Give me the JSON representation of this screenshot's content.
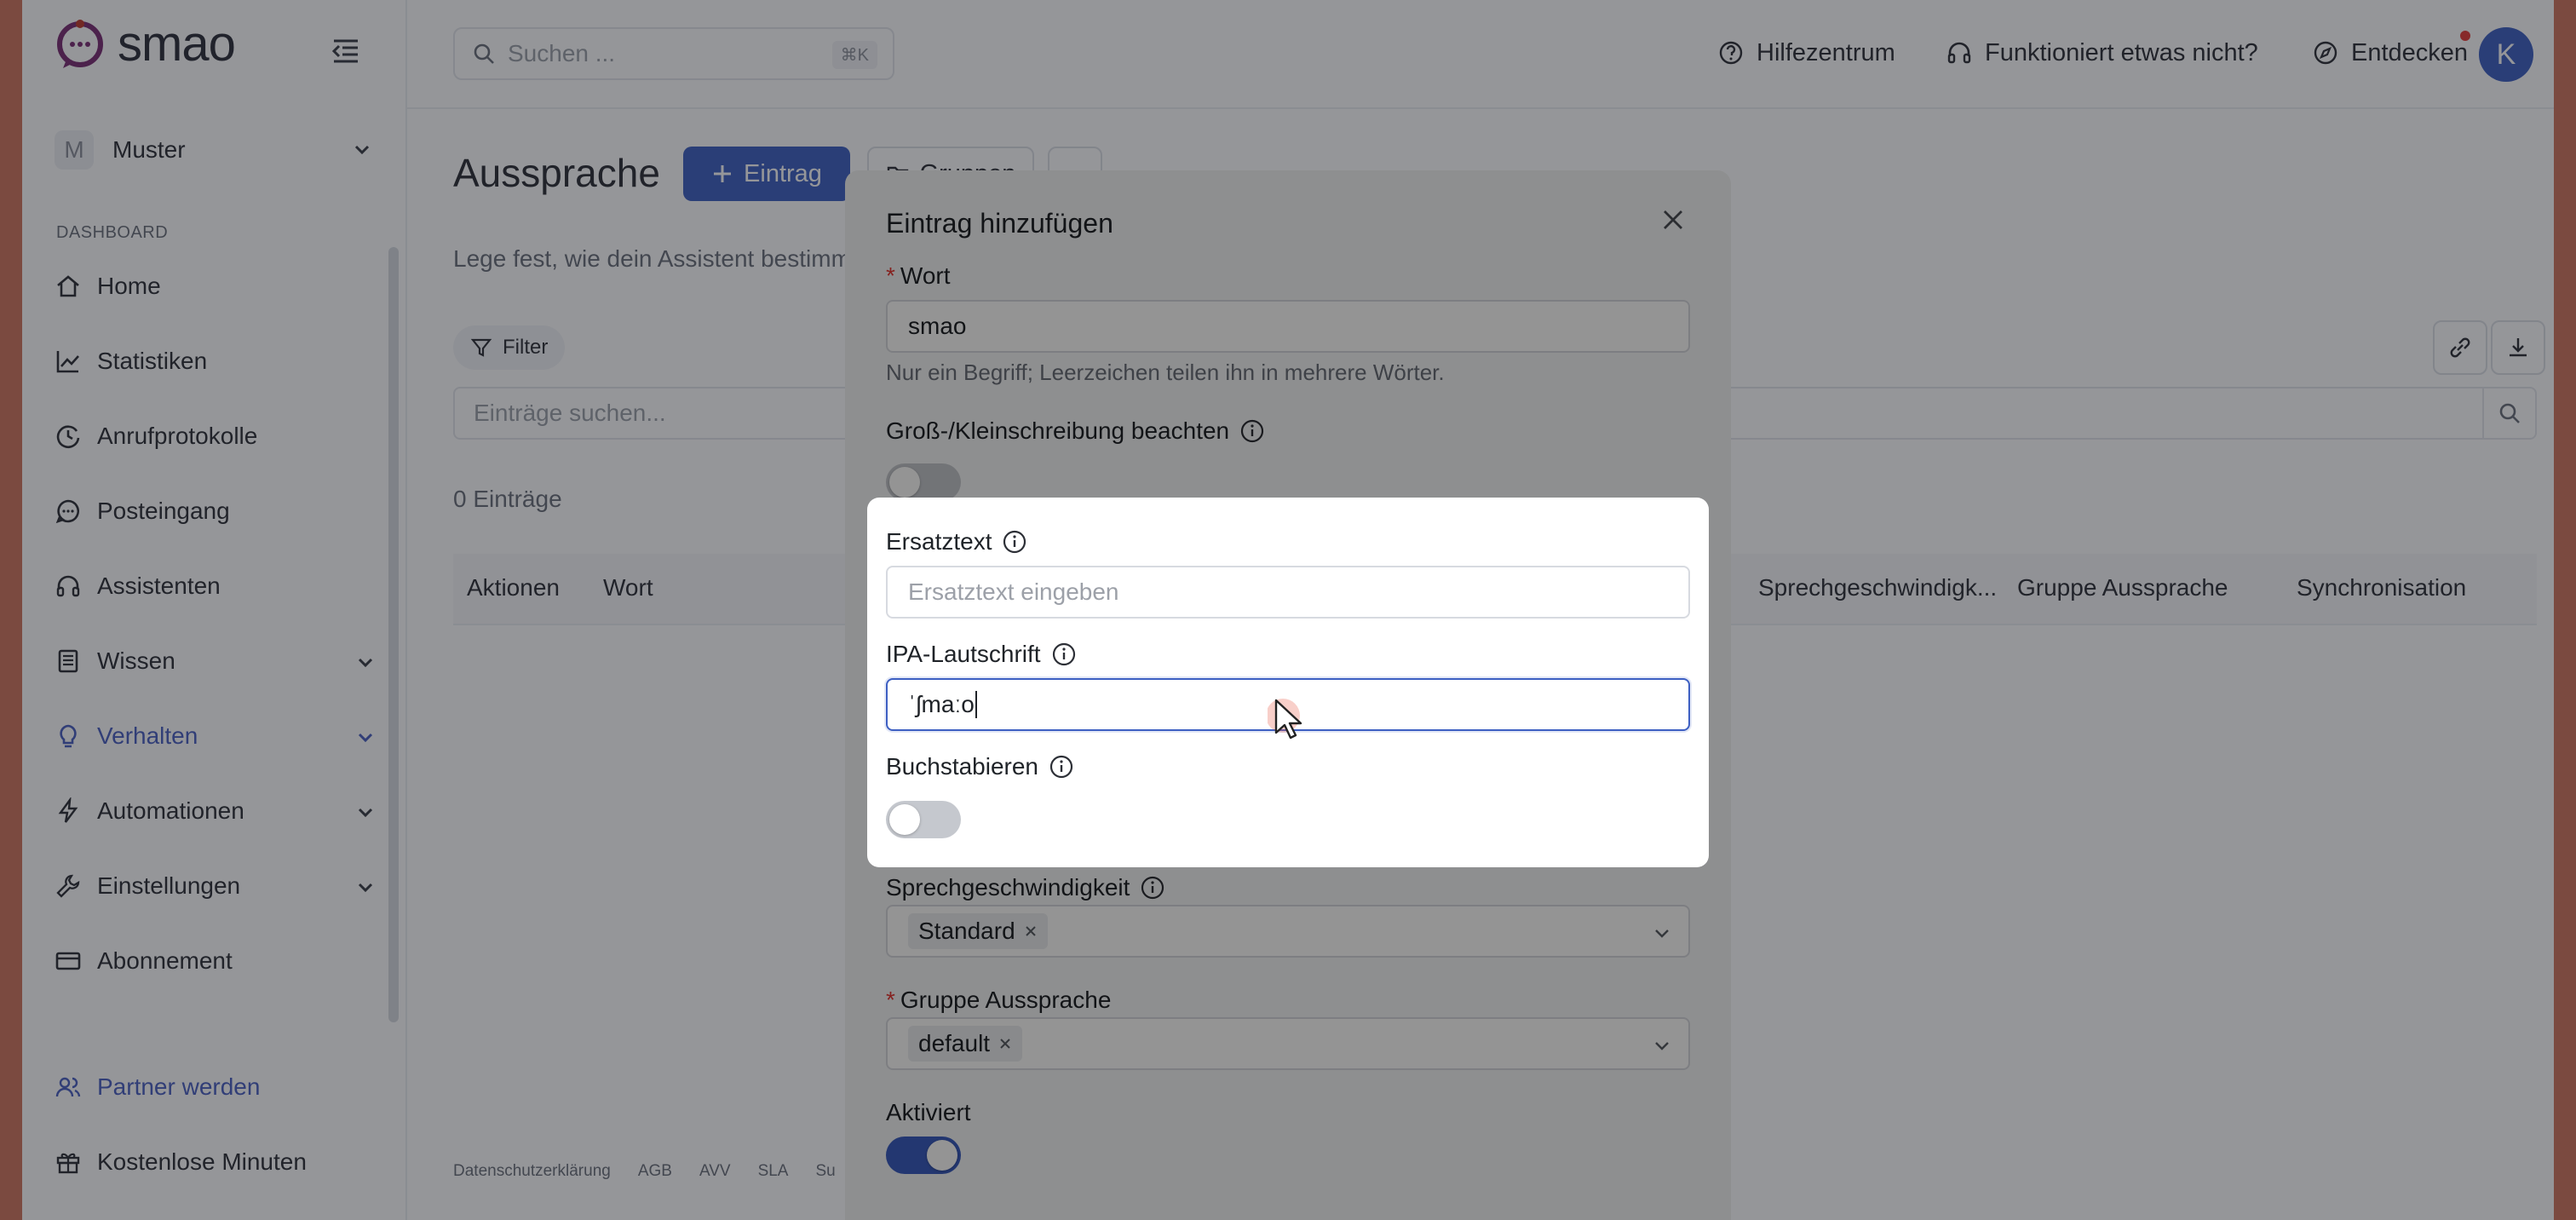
{
  "brand": {
    "name": "smao"
  },
  "workspace": {
    "initial": "M",
    "name": "Muster"
  },
  "sidebar": {
    "section": "DASHBOARD",
    "items": [
      {
        "label": "Home",
        "icon": "home-icon"
      },
      {
        "label": "Statistiken",
        "icon": "chart-icon"
      },
      {
        "label": "Anrufprotokolle",
        "icon": "history-icon"
      },
      {
        "label": "Posteingang",
        "icon": "chat-icon"
      },
      {
        "label": "Assistenten",
        "icon": "headset-icon"
      },
      {
        "label": "Wissen",
        "icon": "book-icon"
      },
      {
        "label": "Verhalten",
        "icon": "bulb-icon"
      },
      {
        "label": "Automationen",
        "icon": "bolt-icon"
      },
      {
        "label": "Einstellungen",
        "icon": "wrench-icon"
      },
      {
        "label": "Abonnement",
        "icon": "card-icon"
      }
    ],
    "partner": "Partner werden",
    "free_minutes": "Kostenlose Minuten"
  },
  "topbar": {
    "search_placeholder": "Suchen ...",
    "search_shortcut": "⌘K",
    "help_center": "Hilfezentrum",
    "not_working": "Funktioniert etwas nicht?",
    "discover": "Entdecken",
    "user_initial": "K"
  },
  "page": {
    "title": "Aussprache",
    "add_button": "Eintrag",
    "groups_button": "Gruppen",
    "subtitle": "Lege fest, wie dein Assistent bestimm",
    "filter": "Filter",
    "entries_search_placeholder": "Einträge suchen...",
    "count": "0 Einträge",
    "columns": [
      "Aktionen",
      "Wort",
      "Sprechgeschwindigk...",
      "Gruppe Aussprache",
      "Synchronisation"
    ],
    "footer": [
      "Datenschutzerklärung",
      "AGB",
      "AVV",
      "SLA",
      "Su"
    ]
  },
  "modal": {
    "title": "Eintrag hinzufügen",
    "word_label": "Wort",
    "word_value": "smao",
    "word_help": "Nur ein Begriff; Leerzeichen teilen ihn in mehrere Wörter.",
    "case_label": "Groß-/Kleinschreibung beachten",
    "replacement_label": "Ersatztext",
    "replacement_placeholder": "Ersatztext eingeben",
    "ipa_label": "IPA-Lautschrift",
    "ipa_value": "ˈʃmaːo",
    "spell_label": "Buchstabieren",
    "speed_label": "Sprechgeschwindigkeit",
    "speed_value": "Standard",
    "group_label": "Gruppe Aussprache",
    "group_value": "default",
    "active_label": "Aktiviert"
  },
  "colors": {
    "accent": "#3d5fc2",
    "required": "#e53935"
  }
}
